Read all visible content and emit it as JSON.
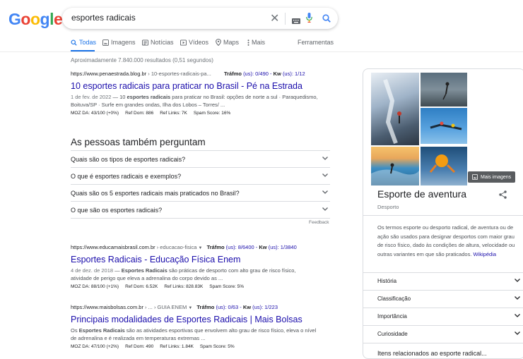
{
  "logo": {
    "text": "Google",
    "colors": [
      "#4285f4",
      "#ea4335",
      "#fbbc05",
      "#4285f4",
      "#34a853",
      "#ea4335"
    ]
  },
  "search": {
    "query": "esportes radicais"
  },
  "tabs": [
    {
      "label": "Todas",
      "icon": "search-icon",
      "active": true
    },
    {
      "label": "Imagens",
      "icon": "image-icon",
      "active": false
    },
    {
      "label": "Notícias",
      "icon": "news-icon",
      "active": false
    },
    {
      "label": "Vídeos",
      "icon": "video-icon",
      "active": false
    },
    {
      "label": "Maps",
      "icon": "map-pin-icon",
      "active": false
    },
    {
      "label": "Mais",
      "icon": "more-vert-icon",
      "active": false
    }
  ],
  "tools_label": "Ferramentas",
  "stats": "Aproximadamente 7.840.000 resultados (0,51 segundos)",
  "results": [
    {
      "url": "https://www.penaestrada.blog.br",
      "path": " › 10-esportes-radicais-pa...",
      "traffic_label": "Tráfmo",
      "traffic": "(us): 0/490",
      "kw_label": "Kw",
      "kw": "(us): 1/12",
      "title": "10 esportes radicais para praticar no Brasil - Pé na Estrada",
      "date": "1 de fev. de 2022",
      "snippet_parts": [
        " — 10 ",
        "esportes radicais",
        " para praticar no Brasil: opções de norte a sul · Paraquedismo, Boituva/SP · Surfe em grandes ondas, Ilha dos Lobos – Torres/ ..."
      ],
      "stats": [
        "MOZ DA: 43/100 (+0%)",
        "Ref Dom: 886",
        "Ref Links: 7K",
        "Spam Score: 16%"
      ]
    },
    {
      "url": "https://www.educamaisbrasil.com.br",
      "path": " › educacao-fisica",
      "traffic_label": "Tráfmo",
      "traffic": "(us): 8/6400",
      "kw_label": "Kw",
      "kw": "(us): 1/3840",
      "title": "Esportes Radicais - Educação Física Enem",
      "date": "4 de dez. de 2018",
      "snippet_parts": [
        " — ",
        "Esportes Radicais",
        " são práticas de desporto com alto grau de risco físico, atividade de perigo que eleva a adrenalina do corpo devido as ..."
      ],
      "stats": [
        "MOZ DA: 88/100 (+1%)",
        "Ref Dom: 6.52K",
        "Ref Links: 828.83K",
        "Spam Score: 5%"
      ]
    },
    {
      "url": "https://www.maisbolsas.com.br",
      "path": " › ... › GUIA ENEM",
      "traffic_label": "Tráfmo",
      "traffic": "(us): 0/63",
      "kw_label": "Kw",
      "kw": "(us): 1/223",
      "title": "Principais modalidades de Esportes Radicais | Mais Bolsas",
      "date": "",
      "snippet_parts": [
        "Os ",
        "Esportes Radicais",
        " são as atividades esportivas que envolvem alto grau de risco físico, eleva o nível de adrenalina e é realizada em temperaturas extremas ..."
      ],
      "stats": [
        "MOZ DA: 47/100 (+2%)",
        "Ref Dom: 490",
        "Ref Links: 1.84K",
        "Spam Score: 5%"
      ]
    }
  ],
  "paa": {
    "title": "As pessoas também perguntam",
    "questions": [
      "Quais são os tipos de esportes radicais?",
      "O que é esportes radicais e exemplos?",
      "Quais são os 5 esportes radicais mais praticados no Brasil?",
      "O que são os esportes radicais?"
    ],
    "feedback": "Feedback"
  },
  "knowledge_panel": {
    "more_images": "Mais imagens",
    "title": "Esporte de aventura",
    "subtitle": "Desporto",
    "description": "Os termos esporte ou desporto radical, de aventura ou de ação são usados para designar desportos com maior grau de risco físico, dado às condições de altura, velocidade ou outras variantes em que são praticados.",
    "source": "Wikipédia",
    "sections": [
      "História",
      "Classificação",
      "Importância",
      "Curiosidade"
    ],
    "cut_text": "Itens relacionados ao esporte radical..."
  }
}
